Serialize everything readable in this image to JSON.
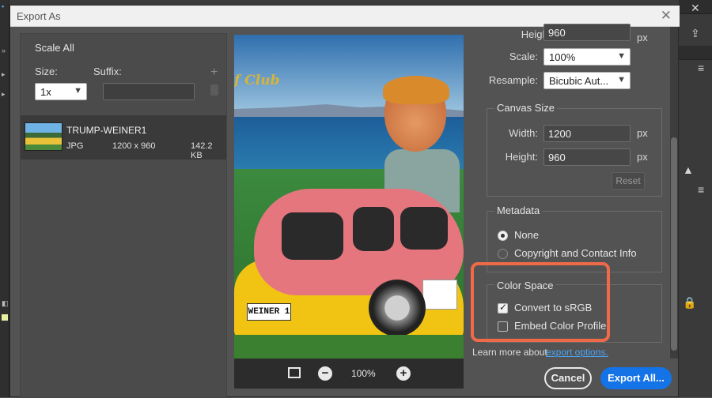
{
  "dialog": {
    "title": "Export As",
    "close_glyph": "✕"
  },
  "left_panel": {
    "header": "Scale All",
    "size_label": "Size:",
    "suffix_label": "Suffix:",
    "size_value": "1x",
    "suffix_value": "",
    "add_glyph": "+",
    "asset": {
      "name": "TRUMP-WEINER1",
      "format": "JPG",
      "dimensions": "1200 x 960",
      "filesize": "142.2 KB"
    }
  },
  "preview": {
    "caption_fragment": "f Club",
    "plate_text": "WEINER 1",
    "zoom_level": "100%",
    "zoom_out_glyph": "−",
    "zoom_in_glyph": "+"
  },
  "image_size": {
    "height_partial": "960",
    "height_label": "Height:",
    "height_unit": "px",
    "scale_label": "Scale:",
    "scale_value": "100%",
    "resample_label": "Resample:",
    "resample_value": "Bicubic Aut..."
  },
  "canvas_size": {
    "title": "Canvas Size",
    "width_label": "Width:",
    "width_value": "1200",
    "height_label": "Height:",
    "height_value": "960",
    "unit": "px",
    "reset_label": "Reset"
  },
  "metadata": {
    "title": "Metadata",
    "options": [
      {
        "label": "None",
        "selected": true
      },
      {
        "label": "Copyright and Contact Info",
        "selected": false
      }
    ]
  },
  "color_space": {
    "title": "Color Space",
    "options": [
      {
        "label": "Convert to sRGB",
        "checked": true
      },
      {
        "label": "Embed Color Profile",
        "checked": false
      }
    ],
    "highlight_color": "#f06a4a"
  },
  "footer": {
    "learn_text": "Learn more about",
    "learn_link": "export options.",
    "cancel_label": "Cancel",
    "export_label": "Export All...",
    "accent": "#1473e6"
  }
}
